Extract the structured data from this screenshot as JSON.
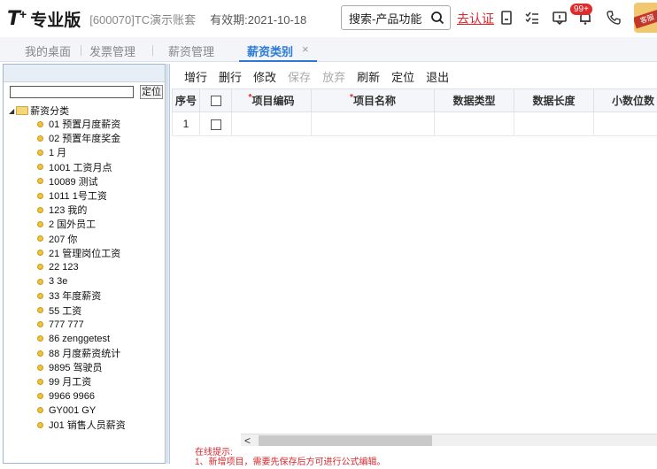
{
  "header": {
    "logo_t": "T",
    "logo_plus": "+",
    "logo_name": "专业版",
    "account": "[600070]TC演示账套",
    "valid": "有效期:2021-10-18",
    "search_label": "搜索-产品功能",
    "certify": "去认证",
    "badge": "99+",
    "avatar_tag": "客服"
  },
  "tabs": [
    {
      "label": "我的桌面"
    },
    {
      "label": "发票管理"
    },
    {
      "label": "薪资管理"
    },
    {
      "label": "薪资类别"
    }
  ],
  "tab_close": "×",
  "tree": {
    "locate_label": "定位",
    "root": "薪资分类",
    "items": [
      "01 预置月度薪资",
      "02 预置年度奖金",
      "1 月",
      "1001 工资月点",
      "10089 测试",
      "1011 1号工资",
      "123 我的",
      "2 国外员工",
      "207 你",
      "21 管理岗位工资",
      "22 123",
      "3 3e",
      "33 年度薪资",
      "55 工资",
      "777 777",
      "86 zenggetest",
      "88 月度薪资统计",
      "9895 驾驶员",
      "99 月工资",
      "9966 9966",
      "GY001 GY",
      "J01 销售人员薪资"
    ]
  },
  "toolbar": {
    "add_row": "增行",
    "delete_row": "删行",
    "modify": "修改",
    "save": "保存",
    "abandon": "放弃",
    "refresh": "刷新",
    "locate": "定位",
    "exit": "退出"
  },
  "grid": {
    "columns": {
      "seq": "序号",
      "code": "项目编码",
      "name": "项目名称",
      "dtype": "数据类型",
      "dlen": "数据长度",
      "decimal": "小数位数"
    },
    "required_mark": "*",
    "rows": [
      {
        "seq": "1"
      }
    ]
  },
  "scroll_left": "<",
  "hint": {
    "title": "在线提示:",
    "line1": "1、新增项目，需要先保存后方可进行公式编辑。"
  }
}
